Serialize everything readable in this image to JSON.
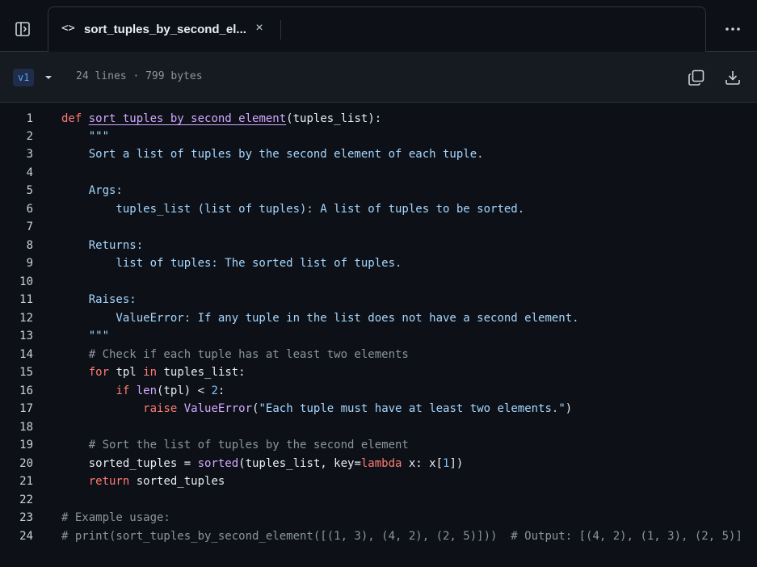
{
  "tab": {
    "title": "sort_tuples_by_second_el...",
    "close_label": "×"
  },
  "toolbar": {
    "version": "v1",
    "meta": "24 lines · 799 bytes"
  },
  "code": {
    "lines": [
      {
        "n": "1",
        "t": "def sort_tuples_by_second_element(tuples_list):"
      },
      {
        "n": "2",
        "t": "    \"\"\""
      },
      {
        "n": "3",
        "t": "    Sort a list of tuples by the second element of each tuple."
      },
      {
        "n": "4",
        "t": ""
      },
      {
        "n": "5",
        "t": "    Args:"
      },
      {
        "n": "6",
        "t": "        tuples_list (list of tuples): A list of tuples to be sorted."
      },
      {
        "n": "7",
        "t": ""
      },
      {
        "n": "8",
        "t": "    Returns:"
      },
      {
        "n": "9",
        "t": "        list of tuples: The sorted list of tuples."
      },
      {
        "n": "10",
        "t": ""
      },
      {
        "n": "11",
        "t": "    Raises:"
      },
      {
        "n": "12",
        "t": "        ValueError: If any tuple in the list does not have a second element."
      },
      {
        "n": "13",
        "t": "    \"\"\""
      },
      {
        "n": "14",
        "t": "    # Check if each tuple has at least two elements"
      },
      {
        "n": "15",
        "t": "    for tpl in tuples_list:"
      },
      {
        "n": "16",
        "t": "        if len(tpl) < 2:"
      },
      {
        "n": "17",
        "t": "            raise ValueError(\"Each tuple must have at least two elements.\")"
      },
      {
        "n": "18",
        "t": ""
      },
      {
        "n": "19",
        "t": "    # Sort the list of tuples by the second element"
      },
      {
        "n": "20",
        "t": "    sorted_tuples = sorted(tuples_list, key=lambda x: x[1])"
      },
      {
        "n": "21",
        "t": "    return sorted_tuples"
      },
      {
        "n": "22",
        "t": ""
      },
      {
        "n": "23",
        "t": "# Example usage:"
      },
      {
        "n": "24",
        "t": "# print(sort_tuples_by_second_element([(1, 3), (4, 2), (2, 5)]))  # Output: [(4, 2), (1, 3), (2, 5)]"
      }
    ]
  },
  "colors": {
    "background": "#0d1117",
    "toolbar": "#161b22",
    "accent": "#f78166",
    "keyword": "#ff7b72",
    "function": "#d2a8ff",
    "string": "#a5d6ff",
    "comment": "#8b949e"
  },
  "icons": {
    "sidebar": "sidebar-toggle-icon",
    "code": "code-icon",
    "close": "close-icon",
    "more": "kebab-icon",
    "copy": "copy-icon",
    "download": "download-icon",
    "caret": "chevron-down-icon"
  }
}
